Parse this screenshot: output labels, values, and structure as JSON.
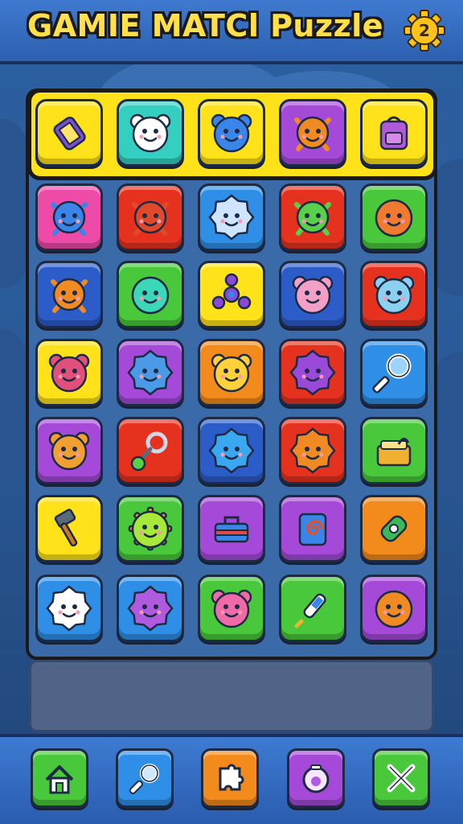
{
  "header": {
    "title": "GAMIE MATCl Puzzle",
    "settings_badge": "2",
    "settings_icon": "gear-icon"
  },
  "colors": {
    "yellow": "#ffe21a",
    "teal": "#34cfc0",
    "blue": "#2f8fe6",
    "purple": "#a54ad8",
    "pink": "#ee4aa8",
    "red": "#e5321f",
    "orange": "#f28a1c",
    "green": "#48c83a",
    "darkblue": "#2c5cc8"
  },
  "board": {
    "rows": [
      [
        {
          "bg": "yellow",
          "icon": "lantern-icon",
          "glyph": "#7a4fd0"
        },
        {
          "bg": "teal",
          "icon": "hamster-icon",
          "glyph": "#ffffff"
        },
        {
          "bg": "yellow",
          "icon": "blue-cat-icon",
          "glyph": "#3a86e8"
        },
        {
          "bg": "purple",
          "icon": "orange-critter-icon",
          "glyph": "#f08a22"
        },
        {
          "bg": "yellow",
          "icon": "backpack-icon",
          "glyph": "#b05ad8"
        }
      ],
      [
        {
          "bg": "pink",
          "icon": "blue-bug-icon",
          "glyph": "#3a86e8"
        },
        {
          "bg": "red",
          "icon": "octopus-icon",
          "glyph": "#e04a2a"
        },
        {
          "bg": "blue",
          "icon": "fluffball-icon",
          "glyph": "#cfe4ff"
        },
        {
          "bg": "red",
          "icon": "green-bug-icon",
          "glyph": "#58d04a"
        },
        {
          "bg": "green",
          "icon": "orange-fish-icon",
          "glyph": "#f07a30"
        }
      ],
      [
        {
          "bg": "darkblue",
          "icon": "orange-lollipop-icon",
          "glyph": "#f08a22"
        },
        {
          "bg": "green",
          "icon": "teal-blob-icon",
          "glyph": "#3ad8b8"
        },
        {
          "bg": "yellow",
          "icon": "fidget-spinner-icon",
          "glyph": "#8a4ad8"
        },
        {
          "bg": "darkblue",
          "icon": "pink-blob-icon",
          "glyph": "#f2a0c8"
        },
        {
          "bg": "red",
          "icon": "blue-bear-icon",
          "glyph": "#8ad0f0"
        }
      ],
      [
        {
          "bg": "yellow",
          "icon": "mushroom-icon",
          "glyph": "#e0507a"
        },
        {
          "bg": "purple",
          "icon": "spiky-blue-icon",
          "glyph": "#4a9ae8"
        },
        {
          "bg": "orange",
          "icon": "yellow-blob-icon",
          "glyph": "#ffd23a"
        },
        {
          "bg": "red",
          "icon": "purple-bug-icon",
          "glyph": "#9a4ad8"
        },
        {
          "bg": "blue",
          "icon": "magnifier-icon",
          "glyph": "#ffffff"
        }
      ],
      [
        {
          "bg": "purple",
          "icon": "orange-bear-icon",
          "glyph": "#f0a030"
        },
        {
          "bg": "red",
          "icon": "green-key-icon",
          "glyph": "#58d04a"
        },
        {
          "bg": "darkblue",
          "icon": "blue-sun-icon",
          "glyph": "#3aa8f0"
        },
        {
          "bg": "red",
          "icon": "orange-sun-icon",
          "glyph": "#f08a22"
        },
        {
          "bg": "green",
          "icon": "book-icon",
          "glyph": "#f0b030"
        }
      ],
      [
        {
          "bg": "yellow",
          "icon": "hammer-icon",
          "glyph": "#5a6a7a"
        },
        {
          "bg": "green",
          "icon": "gear-face-icon",
          "glyph": "#f0a030"
        },
        {
          "bg": "purple",
          "icon": "toolbox-icon",
          "glyph": "#3a86e8"
        },
        {
          "bg": "purple",
          "icon": "spiral-box-icon",
          "glyph": "#e0502a"
        },
        {
          "bg": "orange",
          "icon": "bottle-icon",
          "glyph": "#3ab85a"
        }
      ],
      [
        {
          "bg": "blue",
          "icon": "white-flower-icon",
          "glyph": "#ffffff"
        },
        {
          "bg": "blue",
          "icon": "purple-flower-icon",
          "glyph": "#b05ae0"
        },
        {
          "bg": "green",
          "icon": "pink-ball-icon",
          "glyph": "#f06aa8"
        },
        {
          "bg": "green",
          "icon": "syringe-icon",
          "glyph": "#ffffff"
        },
        {
          "bg": "purple",
          "icon": "orange-fish-icon",
          "glyph": "#f08a22"
        }
      ]
    ]
  },
  "nav": [
    {
      "id": "home",
      "bg": "green",
      "icon": "home-icon"
    },
    {
      "id": "search",
      "bg": "blue",
      "icon": "magnifier-icon"
    },
    {
      "id": "puzzle",
      "bg": "orange",
      "icon": "puzzle-icon"
    },
    {
      "id": "hint",
      "bg": "purple",
      "icon": "fish-bowl-icon"
    },
    {
      "id": "tools",
      "bg": "green",
      "icon": "tools-icon"
    }
  ]
}
